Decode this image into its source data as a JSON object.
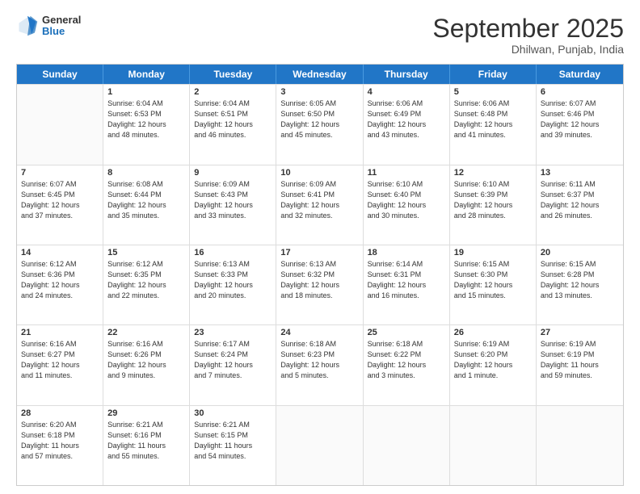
{
  "header": {
    "logo_general": "General",
    "logo_blue": "Blue",
    "month_title": "September 2025",
    "location": "Dhilwan, Punjab, India"
  },
  "days_of_week": [
    "Sunday",
    "Monday",
    "Tuesday",
    "Wednesday",
    "Thursday",
    "Friday",
    "Saturday"
  ],
  "weeks": [
    [
      {
        "day": "",
        "info": ""
      },
      {
        "day": "1",
        "info": "Sunrise: 6:04 AM\nSunset: 6:53 PM\nDaylight: 12 hours\nand 48 minutes."
      },
      {
        "day": "2",
        "info": "Sunrise: 6:04 AM\nSunset: 6:51 PM\nDaylight: 12 hours\nand 46 minutes."
      },
      {
        "day": "3",
        "info": "Sunrise: 6:05 AM\nSunset: 6:50 PM\nDaylight: 12 hours\nand 45 minutes."
      },
      {
        "day": "4",
        "info": "Sunrise: 6:06 AM\nSunset: 6:49 PM\nDaylight: 12 hours\nand 43 minutes."
      },
      {
        "day": "5",
        "info": "Sunrise: 6:06 AM\nSunset: 6:48 PM\nDaylight: 12 hours\nand 41 minutes."
      },
      {
        "day": "6",
        "info": "Sunrise: 6:07 AM\nSunset: 6:46 PM\nDaylight: 12 hours\nand 39 minutes."
      }
    ],
    [
      {
        "day": "7",
        "info": "Sunrise: 6:07 AM\nSunset: 6:45 PM\nDaylight: 12 hours\nand 37 minutes."
      },
      {
        "day": "8",
        "info": "Sunrise: 6:08 AM\nSunset: 6:44 PM\nDaylight: 12 hours\nand 35 minutes."
      },
      {
        "day": "9",
        "info": "Sunrise: 6:09 AM\nSunset: 6:43 PM\nDaylight: 12 hours\nand 33 minutes."
      },
      {
        "day": "10",
        "info": "Sunrise: 6:09 AM\nSunset: 6:41 PM\nDaylight: 12 hours\nand 32 minutes."
      },
      {
        "day": "11",
        "info": "Sunrise: 6:10 AM\nSunset: 6:40 PM\nDaylight: 12 hours\nand 30 minutes."
      },
      {
        "day": "12",
        "info": "Sunrise: 6:10 AM\nSunset: 6:39 PM\nDaylight: 12 hours\nand 28 minutes."
      },
      {
        "day": "13",
        "info": "Sunrise: 6:11 AM\nSunset: 6:37 PM\nDaylight: 12 hours\nand 26 minutes."
      }
    ],
    [
      {
        "day": "14",
        "info": "Sunrise: 6:12 AM\nSunset: 6:36 PM\nDaylight: 12 hours\nand 24 minutes."
      },
      {
        "day": "15",
        "info": "Sunrise: 6:12 AM\nSunset: 6:35 PM\nDaylight: 12 hours\nand 22 minutes."
      },
      {
        "day": "16",
        "info": "Sunrise: 6:13 AM\nSunset: 6:33 PM\nDaylight: 12 hours\nand 20 minutes."
      },
      {
        "day": "17",
        "info": "Sunrise: 6:13 AM\nSunset: 6:32 PM\nDaylight: 12 hours\nand 18 minutes."
      },
      {
        "day": "18",
        "info": "Sunrise: 6:14 AM\nSunset: 6:31 PM\nDaylight: 12 hours\nand 16 minutes."
      },
      {
        "day": "19",
        "info": "Sunrise: 6:15 AM\nSunset: 6:30 PM\nDaylight: 12 hours\nand 15 minutes."
      },
      {
        "day": "20",
        "info": "Sunrise: 6:15 AM\nSunset: 6:28 PM\nDaylight: 12 hours\nand 13 minutes."
      }
    ],
    [
      {
        "day": "21",
        "info": "Sunrise: 6:16 AM\nSunset: 6:27 PM\nDaylight: 12 hours\nand 11 minutes."
      },
      {
        "day": "22",
        "info": "Sunrise: 6:16 AM\nSunset: 6:26 PM\nDaylight: 12 hours\nand 9 minutes."
      },
      {
        "day": "23",
        "info": "Sunrise: 6:17 AM\nSunset: 6:24 PM\nDaylight: 12 hours\nand 7 minutes."
      },
      {
        "day": "24",
        "info": "Sunrise: 6:18 AM\nSunset: 6:23 PM\nDaylight: 12 hours\nand 5 minutes."
      },
      {
        "day": "25",
        "info": "Sunrise: 6:18 AM\nSunset: 6:22 PM\nDaylight: 12 hours\nand 3 minutes."
      },
      {
        "day": "26",
        "info": "Sunrise: 6:19 AM\nSunset: 6:20 PM\nDaylight: 12 hours\nand 1 minute."
      },
      {
        "day": "27",
        "info": "Sunrise: 6:19 AM\nSunset: 6:19 PM\nDaylight: 11 hours\nand 59 minutes."
      }
    ],
    [
      {
        "day": "28",
        "info": "Sunrise: 6:20 AM\nSunset: 6:18 PM\nDaylight: 11 hours\nand 57 minutes."
      },
      {
        "day": "29",
        "info": "Sunrise: 6:21 AM\nSunset: 6:16 PM\nDaylight: 11 hours\nand 55 minutes."
      },
      {
        "day": "30",
        "info": "Sunrise: 6:21 AM\nSunset: 6:15 PM\nDaylight: 11 hours\nand 54 minutes."
      },
      {
        "day": "",
        "info": ""
      },
      {
        "day": "",
        "info": ""
      },
      {
        "day": "",
        "info": ""
      },
      {
        "day": "",
        "info": ""
      }
    ]
  ]
}
